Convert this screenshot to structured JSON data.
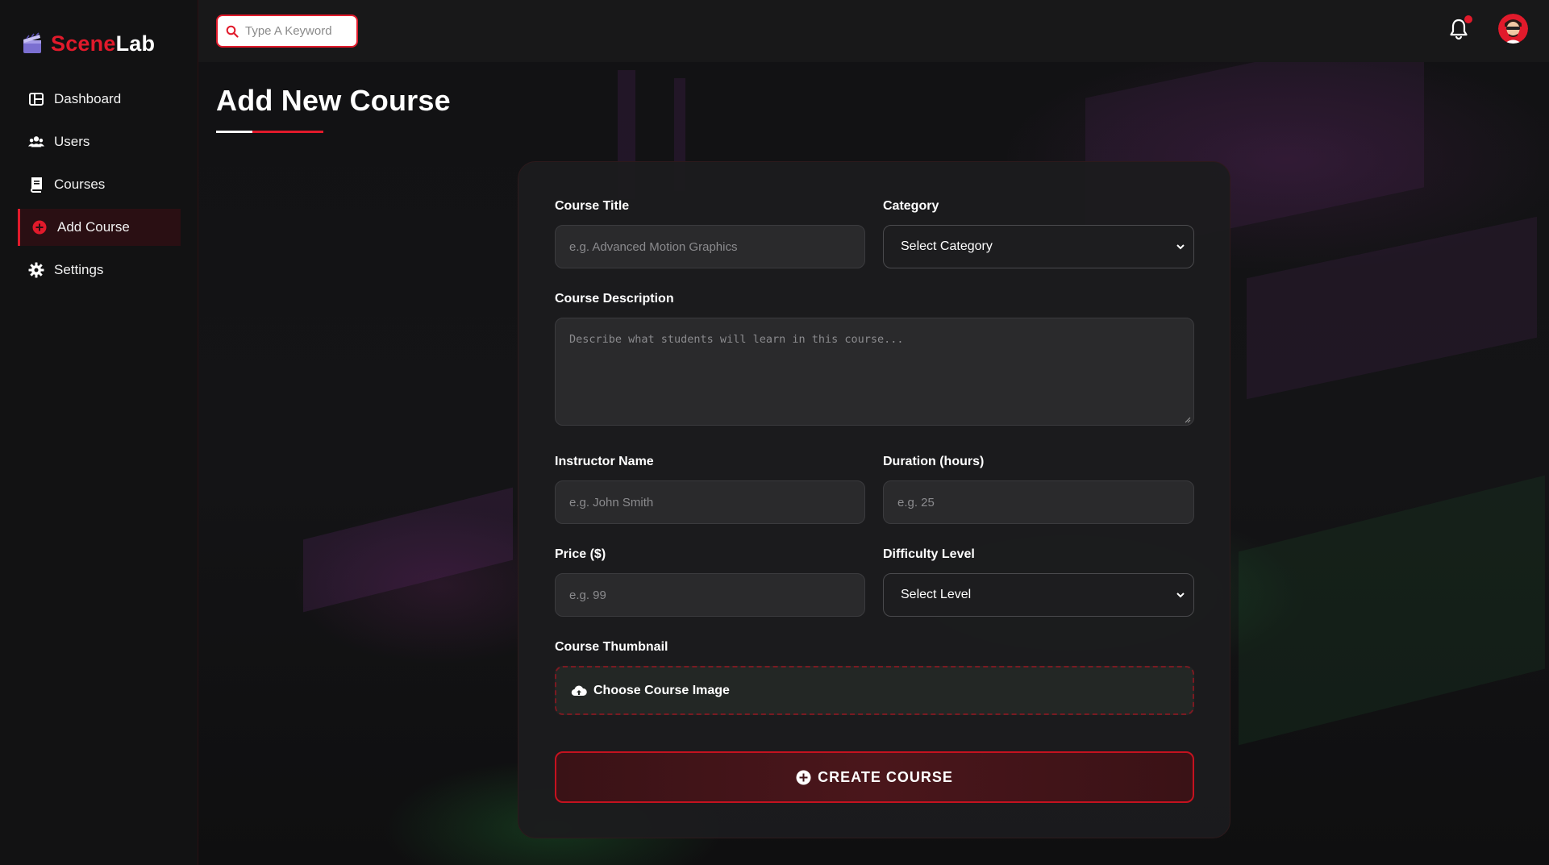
{
  "brand": {
    "name_part1": "Scene",
    "name_part2": "Lab"
  },
  "search": {
    "placeholder": "Type A Keyword"
  },
  "sidebar": {
    "items": [
      {
        "label": "Dashboard",
        "icon": "dashboard-icon",
        "active": false
      },
      {
        "label": "Users",
        "icon": "users-icon",
        "active": false
      },
      {
        "label": "Courses",
        "icon": "book-icon",
        "active": false
      },
      {
        "label": "Add Course",
        "icon": "plus-circle-icon",
        "active": true
      },
      {
        "label": "Settings",
        "icon": "gear-icon",
        "active": false
      }
    ]
  },
  "header": {
    "notification_badge": true
  },
  "page": {
    "title": "Add New Course"
  },
  "form": {
    "course_title": {
      "label": "Course Title",
      "placeholder": "e.g. Advanced Motion Graphics"
    },
    "category": {
      "label": "Category",
      "selected": "Select Category"
    },
    "description": {
      "label": "Course Description",
      "placeholder": "Describe what students will learn in this course..."
    },
    "instructor": {
      "label": "Instructor Name",
      "placeholder": "e.g. John Smith"
    },
    "duration": {
      "label": "Duration (hours)",
      "placeholder": "e.g. 25"
    },
    "price": {
      "label": "Price ($)",
      "placeholder": "e.g. 99"
    },
    "difficulty": {
      "label": "Difficulty Level",
      "selected": "Select Level"
    },
    "thumbnail": {
      "label": "Course Thumbnail",
      "button_label": "Choose Course Image"
    },
    "submit_label": "CREATE COURSE"
  },
  "colors": {
    "accent": "#e11a2b",
    "sidebar_bg": "#121213",
    "topbar_bg": "#181819",
    "card_bg": "#1c1c1e"
  }
}
